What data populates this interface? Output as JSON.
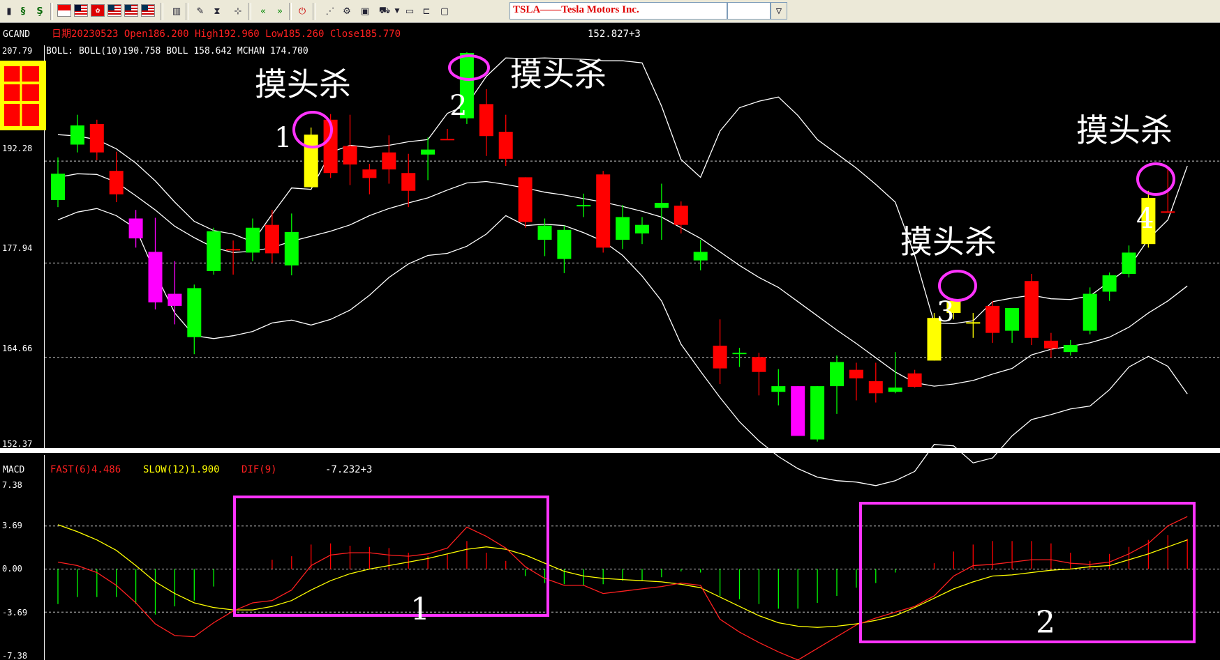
{
  "toolbar": {
    "symbol": "TSLA——Tesla Motors Inc.",
    "period_value": "",
    "icons": [
      "stop-icon",
      "s-arrows-icon",
      "s-flag-icon",
      "flag-sg",
      "flag-my",
      "flag-hk",
      "flag-us",
      "flag-us",
      "flag-us",
      "bar-chart-icon",
      "edit-icon",
      "hourglass-icon",
      "network-icon",
      "rewind-icon",
      "fast-forward-icon",
      "power-icon",
      "chart-draw-icon",
      "gear-icon",
      "window-icon",
      "cart-icon",
      "folder-icon",
      "folder-open-icon",
      "monitor-icon"
    ]
  },
  "price_panel": {
    "indicator_name": "GCAND",
    "info": "日期20230523 Open186.200 High192.960 Low185.260 Close185.770",
    "cursor_value": "152.827+3",
    "boll_text": "BOLL: BOLL(10)190.758  BOLL 158.642  MCHAN 174.700",
    "y_labels": [
      "207.79",
      "192.28",
      "177.94",
      "164.66",
      "152.37"
    ]
  },
  "macd_panel": {
    "indicator_name": "MACD",
    "fast": "FAST(6)4.486",
    "slow": "SLOW(12)1.900",
    "dif": "DIF(9)",
    "cursor_value": "-7.232+3",
    "y_labels": [
      "7.38",
      "3.69",
      "0.00",
      "-3.69",
      "-7.38"
    ]
  },
  "annotations": {
    "signal_text": "摸头杀",
    "markers": [
      "1",
      "2",
      "3",
      "4"
    ],
    "box_labels": [
      "1",
      "2"
    ]
  },
  "colors": {
    "up": "#ff0000",
    "down": "#00ff00",
    "signal": "#ffff00",
    "extra": "#ff00ff",
    "annotation": "#ff33ff",
    "boll": "#ffffff",
    "fast": "#ff2020",
    "slow": "#ffff00"
  },
  "chart_data": {
    "type": "candlestick",
    "price_range": [
      152.37,
      207.79
    ],
    "candles": [
      {
        "o": 186.8,
        "c": 190.5,
        "h": 192.8,
        "l": 185.8,
        "color": "green"
      },
      {
        "o": 194.6,
        "c": 197.3,
        "h": 198.8,
        "l": 193.5,
        "color": "green"
      },
      {
        "o": 197.5,
        "c": 193.5,
        "h": 198.1,
        "l": 192.4,
        "color": "red"
      },
      {
        "o": 190.9,
        "c": 187.6,
        "h": 193.6,
        "l": 186.5,
        "color": "red"
      },
      {
        "o": 184.2,
        "c": 181.4,
        "h": 185.4,
        "l": 180.1,
        "color": "magenta"
      },
      {
        "o": 179.5,
        "c": 172.4,
        "h": 184.3,
        "l": 171.4,
        "color": "magenta"
      },
      {
        "o": 173.6,
        "c": 171.9,
        "h": 178.2,
        "l": 169.3,
        "color": "magenta"
      },
      {
        "o": 167.5,
        "c": 174.4,
        "h": 174.9,
        "l": 165.1,
        "color": "green"
      },
      {
        "o": 176.8,
        "c": 182.4,
        "h": 182.9,
        "l": 176.3,
        "color": "green"
      },
      {
        "o": 179.9,
        "c": 179.7,
        "h": 181.1,
        "l": 176.3,
        "color": "red"
      },
      {
        "o": 179.4,
        "c": 182.9,
        "h": 184.2,
        "l": 178.2,
        "color": "green"
      },
      {
        "o": 183.3,
        "c": 179.3,
        "h": 185.4,
        "l": 177.9,
        "color": "red"
      },
      {
        "o": 177.6,
        "c": 182.3,
        "h": 184.9,
        "l": 176.2,
        "color": "green"
      },
      {
        "o": 188.6,
        "c": 196.0,
        "h": 197.0,
        "l": 188.6,
        "color": "yellow"
      },
      {
        "o": 190.6,
        "c": 198.1,
        "h": 198.9,
        "l": 189.9,
        "color": "red"
      },
      {
        "o": 191.8,
        "c": 194.4,
        "h": 198.8,
        "l": 188.9,
        "color": "red"
      },
      {
        "o": 189.9,
        "c": 191.1,
        "h": 191.9,
        "l": 187.6,
        "color": "red"
      },
      {
        "o": 191.1,
        "c": 193.5,
        "h": 195.9,
        "l": 189.1,
        "color": "red"
      },
      {
        "o": 188.1,
        "c": 190.6,
        "h": 193.3,
        "l": 185.8,
        "color": "red"
      },
      {
        "o": 193.9,
        "c": 193.2,
        "h": 195.6,
        "l": 189.6,
        "color": "green"
      },
      {
        "o": 195.4,
        "c": 195.4,
        "h": 196.8,
        "l": 195.4,
        "color": "red"
      },
      {
        "o": 198.3,
        "c": 207.5,
        "h": 207.6,
        "l": 197.5,
        "color": "green"
      },
      {
        "o": 195.8,
        "c": 200.3,
        "h": 202.4,
        "l": 193.0,
        "color": "red"
      },
      {
        "o": 192.6,
        "c": 196.4,
        "h": 198.8,
        "l": 191.6,
        "color": "red"
      },
      {
        "o": 183.7,
        "c": 190.0,
        "h": 190.0,
        "l": 182.9,
        "color": "red"
      },
      {
        "o": 181.2,
        "c": 183.2,
        "h": 184.2,
        "l": 178.9,
        "color": "green"
      },
      {
        "o": 178.5,
        "c": 182.6,
        "h": 183.2,
        "l": 176.5,
        "color": "green"
      },
      {
        "o": 186.1,
        "c": 186.1,
        "h": 187.7,
        "l": 184.4,
        "color": "green"
      },
      {
        "o": 180.1,
        "c": 190.4,
        "h": 190.9,
        "l": 179.4,
        "color": "red"
      },
      {
        "o": 181.2,
        "c": 184.4,
        "h": 186.1,
        "l": 179.9,
        "color": "green"
      },
      {
        "o": 182.1,
        "c": 183.3,
        "h": 184.4,
        "l": 180.6,
        "color": "green"
      },
      {
        "o": 185.7,
        "c": 186.4,
        "h": 189.1,
        "l": 181.2,
        "color": "green"
      },
      {
        "o": 183.3,
        "c": 186.0,
        "h": 186.6,
        "l": 182.1,
        "color": "red"
      },
      {
        "o": 178.3,
        "c": 179.5,
        "h": 181.2,
        "l": 176.9,
        "color": "green"
      },
      {
        "o": 163.1,
        "c": 166.3,
        "h": 170.0,
        "l": 160.9,
        "color": "red"
      },
      {
        "o": 165.3,
        "c": 165.3,
        "h": 166.0,
        "l": 163.3,
        "color": "green"
      },
      {
        "o": 162.6,
        "c": 164.7,
        "h": 165.3,
        "l": 159.3,
        "color": "red"
      },
      {
        "o": 160.6,
        "c": 159.8,
        "h": 163.0,
        "l": 157.9,
        "color": "green"
      },
      {
        "o": 153.6,
        "c": 160.6,
        "h": 160.6,
        "l": 153.6,
        "color": "magenta"
      },
      {
        "o": 160.6,
        "c": 153.1,
        "h": 160.6,
        "l": 152.8,
        "color": "green"
      },
      {
        "o": 164.0,
        "c": 160.6,
        "h": 164.9,
        "l": 156.7,
        "color": "green"
      },
      {
        "o": 161.7,
        "c": 162.9,
        "h": 163.9,
        "l": 158.6,
        "color": "red"
      },
      {
        "o": 159.6,
        "c": 161.3,
        "h": 163.9,
        "l": 158.3,
        "color": "red"
      },
      {
        "o": 160.4,
        "c": 159.8,
        "h": 165.4,
        "l": 159.6,
        "color": "green"
      },
      {
        "o": 162.4,
        "c": 160.5,
        "h": 162.9,
        "l": 160.4,
        "color": "red"
      },
      {
        "o": 164.2,
        "c": 170.2,
        "h": 170.9,
        "l": 164.2,
        "color": "yellow"
      },
      {
        "o": 170.9,
        "c": 172.6,
        "h": 172.6,
        "l": 170.0,
        "color": "yellow"
      },
      {
        "o": 169.6,
        "c": 169.6,
        "h": 170.9,
        "l": 167.4,
        "color": "yellow"
      },
      {
        "o": 168.1,
        "c": 171.9,
        "h": 172.6,
        "l": 166.7,
        "color": "red"
      },
      {
        "o": 168.4,
        "c": 171.6,
        "h": 171.6,
        "l": 166.7,
        "color": "green"
      },
      {
        "o": 167.4,
        "c": 175.4,
        "h": 176.4,
        "l": 166.4,
        "color": "red"
      },
      {
        "o": 167.0,
        "c": 165.9,
        "h": 168.1,
        "l": 164.6,
        "color": "red"
      },
      {
        "o": 166.4,
        "c": 165.4,
        "h": 167.1,
        "l": 164.9,
        "color": "green"
      },
      {
        "o": 168.4,
        "c": 173.6,
        "h": 174.5,
        "l": 167.9,
        "color": "green"
      },
      {
        "o": 176.2,
        "c": 173.9,
        "h": 176.6,
        "l": 172.6,
        "color": "green"
      },
      {
        "o": 179.4,
        "c": 176.4,
        "h": 180.4,
        "l": 175.9,
        "color": "green"
      },
      {
        "o": 187.1,
        "c": 180.6,
        "h": 188.1,
        "l": 180.1,
        "color": "yellow"
      },
      {
        "o": 185.2,
        "c": 185.1,
        "h": 191.2,
        "l": 185.1,
        "color": "red"
      }
    ],
    "boll_upper": [
      196.0,
      195.8,
      195.3,
      194.0,
      192.0,
      189.5,
      186.5,
      183.8,
      182.5,
      182.0,
      180.9,
      184.8,
      188.5,
      188.3,
      193.5,
      194.5,
      194.2,
      194.5,
      195.0,
      195.3,
      199.0,
      200.2,
      204.2,
      206.8,
      206.7,
      206.8,
      206.7,
      206.6,
      206.4,
      206.4,
      206.1,
      200.0,
      192.5,
      190.0,
      196.5,
      199.8,
      200.7,
      201.3,
      198.7,
      195.3,
      193.3,
      191.3,
      189.0,
      186.5,
      179.0,
      169.5,
      169.4,
      169.8,
      172.5,
      173.0,
      173.4,
      172.9,
      172.8,
      173.3,
      175.3,
      177.3,
      181.3,
      184.0,
      191.6
    ],
    "boll_mid": [
      190.0,
      190.5,
      190.4,
      189.3,
      187.4,
      185.4,
      183.1,
      181.5,
      180.1,
      179.4,
      179.6,
      180.1,
      181.0,
      181.7,
      182.4,
      183.3,
      184.6,
      185.6,
      186.4,
      187.1,
      188.2,
      189.2,
      189.4,
      189.0,
      188.5,
      187.9,
      187.5,
      187.0,
      186.5,
      185.9,
      185.2,
      184.4,
      182.9,
      181.4,
      179.5,
      177.6,
      175.9,
      174.5,
      172.5,
      170.5,
      168.5,
      166.6,
      164.6,
      162.6,
      161.1,
      160.6,
      160.9,
      161.4,
      162.3,
      163.1,
      165.0,
      165.8,
      166.2,
      166.7,
      167.5,
      168.9,
      170.9,
      172.6,
      174.7
    ],
    "boll_lower": [
      184.0,
      185.1,
      185.6,
      184.6,
      182.8,
      176.5,
      170.9,
      167.7,
      167.3,
      167.7,
      168.3,
      169.5,
      169.9,
      169.2,
      170.0,
      171.3,
      173.4,
      175.9,
      177.8,
      179.0,
      179.3,
      180.3,
      182.0,
      184.6,
      183.2,
      183.4,
      183.2,
      182.2,
      181.0,
      179.0,
      176.1,
      172.6,
      166.5,
      162.7,
      159.0,
      155.6,
      152.9,
      150.7,
      149.0,
      147.8,
      147.3,
      147.1,
      146.6,
      147.3,
      148.6,
      152.4,
      152.2,
      149.8,
      150.5,
      153.6,
      155.9,
      156.6,
      157.4,
      157.8,
      160.1,
      163.3,
      164.8,
      163.4,
      159.5
    ],
    "macd_range": [
      -7.38,
      7.38
    ],
    "macd_fast": [
      0.6,
      0.3,
      -0.3,
      -1.4,
      -2.9,
      -4.7,
      -5.7,
      -5.8,
      -4.6,
      -3.6,
      -2.9,
      -2.7,
      -1.8,
      0.3,
      1.2,
      1.4,
      1.4,
      1.2,
      1.1,
      1.3,
      1.8,
      3.6,
      2.8,
      1.8,
      0.2,
      -0.8,
      -1.4,
      -1.4,
      -2.1,
      -1.9,
      -1.7,
      -1.5,
      -1.2,
      -1.4,
      -4.3,
      -5.4,
      -6.3,
      -7.1,
      -7.8,
      -6.8,
      -5.8,
      -4.8,
      -4.2,
      -3.7,
      -3.2,
      -2.3,
      -0.6,
      0.3,
      0.4,
      0.6,
      0.8,
      0.8,
      0.5,
      0.4,
      0.6,
      1.3,
      2.2,
      3.7,
      4.5
    ],
    "macd_slow": [
      3.8,
      3.2,
      2.5,
      1.6,
      0.3,
      -1.1,
      -2.1,
      -2.9,
      -3.3,
      -3.5,
      -3.5,
      -3.2,
      -2.7,
      -1.8,
      -1.0,
      -0.4,
      0.0,
      0.3,
      0.6,
      0.9,
      1.3,
      1.7,
      1.9,
      1.7,
      1.2,
      0.5,
      -0.2,
      -0.6,
      -0.8,
      -0.9,
      -1.0,
      -1.1,
      -1.3,
      -1.6,
      -2.4,
      -3.2,
      -4.0,
      -4.6,
      -4.9,
      -5.0,
      -4.9,
      -4.7,
      -4.4,
      -4.0,
      -3.3,
      -2.5,
      -1.7,
      -1.1,
      -0.6,
      -0.5,
      -0.3,
      -0.1,
      0.0,
      0.2,
      0.3,
      0.8,
      1.3,
      1.9,
      2.5
    ],
    "macd_hist": [
      -3.0,
      -2.4,
      -2.4,
      -2.4,
      -3.0,
      -3.9,
      -3.2,
      -2.7,
      -1.5,
      0.0,
      0.0,
      0.8,
      1.1,
      2.1,
      2.2,
      2.0,
      1.9,
      1.8,
      1.4,
      1.1,
      1.3,
      2.4,
      1.4,
      0.7,
      -0.6,
      -1.2,
      -1.3,
      -1.4,
      -1.3,
      -1.0,
      -1.0,
      -0.7,
      -0.2,
      -0.3,
      -2.3,
      -2.6,
      -3.0,
      -3.4,
      -3.4,
      -2.9,
      -2.3,
      -1.6,
      -1.2,
      -0.3,
      0.0,
      0.5,
      1.5,
      2.1,
      2.4,
      2.4,
      2.4,
      2.2,
      1.4,
      0.7,
      1.3,
      1.9,
      2.5,
      2.9,
      2.6
    ]
  }
}
